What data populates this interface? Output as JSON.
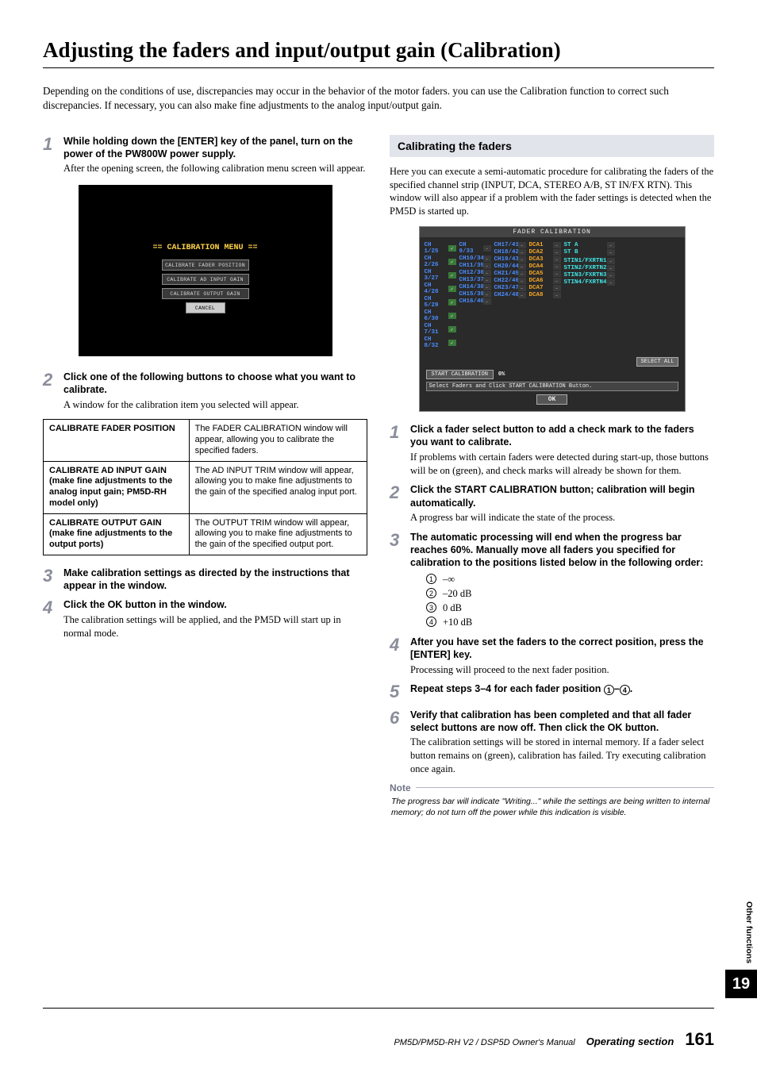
{
  "title": "Adjusting the faders and input/output gain (Calibration)",
  "intro": "Depending on the conditions of use, discrepancies may occur in the behavior of the motor faders. you can use the Calibration function to correct such discrepancies. If necessary, you can also make fine adjustments to the analog input/output gain.",
  "left": {
    "step1": {
      "num": "1",
      "head": "While holding down the [ENTER] key of the panel, turn on the power of the PW800W power supply.",
      "desc": "After the opening screen, the following calibration menu screen will appear."
    },
    "cal_menu": {
      "title": "== CALIBRATION MENU ==",
      "btn1": "CALIBRATE FADER POSITION",
      "btn2": "CALIBRATE AD INPUT GAIN",
      "btn3": "CALIBRATE OUTPUT GAIN",
      "btn4": "CANCEL"
    },
    "step2": {
      "num": "2",
      "head": "Click one of the following buttons to choose what you want to calibrate.",
      "desc": "A window for the calibration item you selected will appear."
    },
    "table": {
      "r1c1": "CALIBRATE FADER POSITION",
      "r1c2": "The FADER CALIBRATION window will appear, allowing you to calibrate the specified faders.",
      "r2c1": "CALIBRATE AD INPUT GAIN (make fine adjustments to the analog input gain; PM5D-RH model only)",
      "r2c2": "The AD INPUT TRIM window will appear, allowing you to make fine adjustments to the gain of the specified analog input port.",
      "r3c1": "CALIBRATE OUTPUT GAIN (make fine adjustments to the output ports)",
      "r3c2": "The OUTPUT TRIM window will appear, allowing you to make fine adjustments to the gain of the specified output port."
    },
    "step3": {
      "num": "3",
      "head": "Make calibration settings as directed by the instructions that appear in the window."
    },
    "step4": {
      "num": "4",
      "head": "Click the OK button in the window.",
      "desc": "The calibration settings will be applied, and the PM5D will start up in normal mode."
    }
  },
  "right": {
    "section": "Calibrating the faders",
    "intro": "Here you can execute a semi-automatic procedure for calibrating the faders of the specified channel strip (INPUT, DCA, STEREO A/B, ST IN/FX RTN). This window will also appear if a problem with the fader settings is detected when the PM5D is started up.",
    "fader_screen": {
      "title": "FADER CALIBRATION",
      "cols": [
        [
          "CH 1/25",
          "CH 2/26",
          "CH 3/27",
          "CH 4/28",
          "CH 5/29",
          "CH 6/30",
          "CH 7/31",
          "CH 8/32"
        ],
        [
          "CH 9/33",
          "CH10/34",
          "CH11/35",
          "CH12/36",
          "CH13/37",
          "CH14/38",
          "CH15/39",
          "CH16/40"
        ],
        [
          "CH17/41",
          "CH18/42",
          "CH19/43",
          "CH20/44",
          "CH21/45",
          "CH22/46",
          "CH23/47",
          "CH24/48"
        ],
        [
          "DCA1",
          "DCA2",
          "DCA3",
          "DCA4",
          "DCA5",
          "DCA6",
          "DCA7",
          "DCA8"
        ],
        [
          "ST A",
          "ST B",
          "",
          "",
          "STIN1/FXRTN1",
          "STIN2/FXRTN2",
          "STIN3/FXRTN3",
          "STIN4/FXRTN4"
        ]
      ],
      "select_all": "SELECT ALL",
      "start": "START CALIBRATION",
      "progress": "0%",
      "msg": "Select Faders and Click START CALIBRATION Button.",
      "ok": "OK"
    },
    "step1": {
      "num": "1",
      "head": "Click a fader select button to add a check mark to the faders you want to calibrate.",
      "desc": "If problems with certain faders were detected during start-up, those buttons will be on (green), and check marks will already be shown for them."
    },
    "step2": {
      "num": "2",
      "head": "Click the START CALIBRATION button; calibration will begin automatically.",
      "desc": "A progress bar will indicate the state of the process."
    },
    "step3": {
      "num": "3",
      "head": "The automatic processing will end when the progress bar reaches 60%. Manually move all faders you specified for calibration to the positions listed below in the following order:",
      "sub": [
        "–∞",
        "–20 dB",
        "0 dB",
        "+10 dB"
      ]
    },
    "step4": {
      "num": "4",
      "head": "After you have set the faders to the correct position, press the [ENTER] key.",
      "desc": "Processing will proceed to the next fader position."
    },
    "step5": {
      "num": "5",
      "head": "Repeat steps 3–4 for each fader position ①–④."
    },
    "step6": {
      "num": "6",
      "head": "Verify that calibration has been completed and that all fader select buttons are now off. Then click the OK button.",
      "desc": "The calibration settings will be stored in internal memory. If a fader select button remains on (green), calibration has failed. Try executing calibration once again."
    },
    "note": {
      "title": "Note",
      "body": "The progress bar will indicate \"Writing...\" while the settings are being written to internal memory; do not turn off the power while this indication is visible."
    }
  },
  "side": {
    "label": "Other functions",
    "chapter": "19"
  },
  "footer": {
    "manual": "PM5D/PM5D-RH V2 / DSP5D Owner's Manual",
    "section": "Operating section",
    "page": "161"
  }
}
